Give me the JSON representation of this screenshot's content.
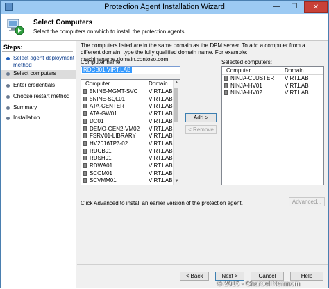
{
  "window": {
    "title": "Protection Agent Installation Wizard",
    "min_glyph": "—",
    "max_glyph": "☐",
    "close_glyph": "✕"
  },
  "header": {
    "title": "Select Computers",
    "subtitle": "Select the computers on which to install the protection agents.",
    "icon": "computer-shield-icon"
  },
  "steps": {
    "title": "Steps:",
    "items": [
      {
        "label": "Select agent deployment method",
        "state": "done"
      },
      {
        "label": "Select computers",
        "state": "current"
      },
      {
        "label": "Enter credentials",
        "state": "pending"
      },
      {
        "label": "Choose restart method",
        "state": "pending"
      },
      {
        "label": "Summary",
        "state": "pending"
      },
      {
        "label": "Installation",
        "state": "pending"
      }
    ]
  },
  "main": {
    "intro": "The computers listed are in the same domain as the DPM server. To add a computer from a different domain, type the fully qualified domain name. For example: machinename.domain.contoso.com",
    "computer_name_label": "Computer name:",
    "computer_name_value": "RDCB01.VIRT.LAB",
    "available": {
      "col_computer": "Computer",
      "col_domain": "Domain",
      "rows": [
        {
          "computer": "5NINE-MGMT-SVC",
          "domain": "VIRT.LAB"
        },
        {
          "computer": "5NINE-SQL01",
          "domain": "VIRT.LAB"
        },
        {
          "computer": "ATA-CENTER",
          "domain": "VIRT.LAB"
        },
        {
          "computer": "ATA-GW01",
          "domain": "VIRT.LAB"
        },
        {
          "computer": "DC01",
          "domain": "VIRT.LAB"
        },
        {
          "computer": "DEMO-GEN2-VM02",
          "domain": "VIRT.LAB"
        },
        {
          "computer": "FSRV01-LIBRARY",
          "domain": "VIRT.LAB"
        },
        {
          "computer": "HV2016TP3-02",
          "domain": "VIRT.LAB"
        },
        {
          "computer": "RDCB01",
          "domain": "VIRT.LAB"
        },
        {
          "computer": "RDSH01",
          "domain": "VIRT.LAB"
        },
        {
          "computer": "RDWA01",
          "domain": "VIRT.LAB"
        },
        {
          "computer": "SCOM01",
          "domain": "VIRT.LAB"
        },
        {
          "computer": "SCVMM01",
          "domain": "VIRT.LAB"
        }
      ]
    },
    "add_button": "Add >",
    "remove_button": "< Remove",
    "selected_label": "Selected computers:",
    "selected": {
      "col_computer": "Computer",
      "col_domain": "Domain",
      "rows": [
        {
          "computer": "NINJA-CLUSTER",
          "domain": "VIRT.LAB"
        },
        {
          "computer": "NINJA-HV01",
          "domain": "VIRT.LAB"
        },
        {
          "computer": "NINJA-HV02",
          "domain": "VIRT.LAB"
        }
      ]
    },
    "advanced_text": "Click Advanced to install an earlier version of the protection agent.",
    "advanced_button": "Advanced..."
  },
  "footer": {
    "back": "< Back",
    "next": "Next >",
    "cancel": "Cancel",
    "help": "Help"
  },
  "watermark": "© 2015 - Charbel Nemnom",
  "colors": {
    "titlebar": "#9ccaf3",
    "selection": "#3399ff",
    "close": "#c84138"
  }
}
